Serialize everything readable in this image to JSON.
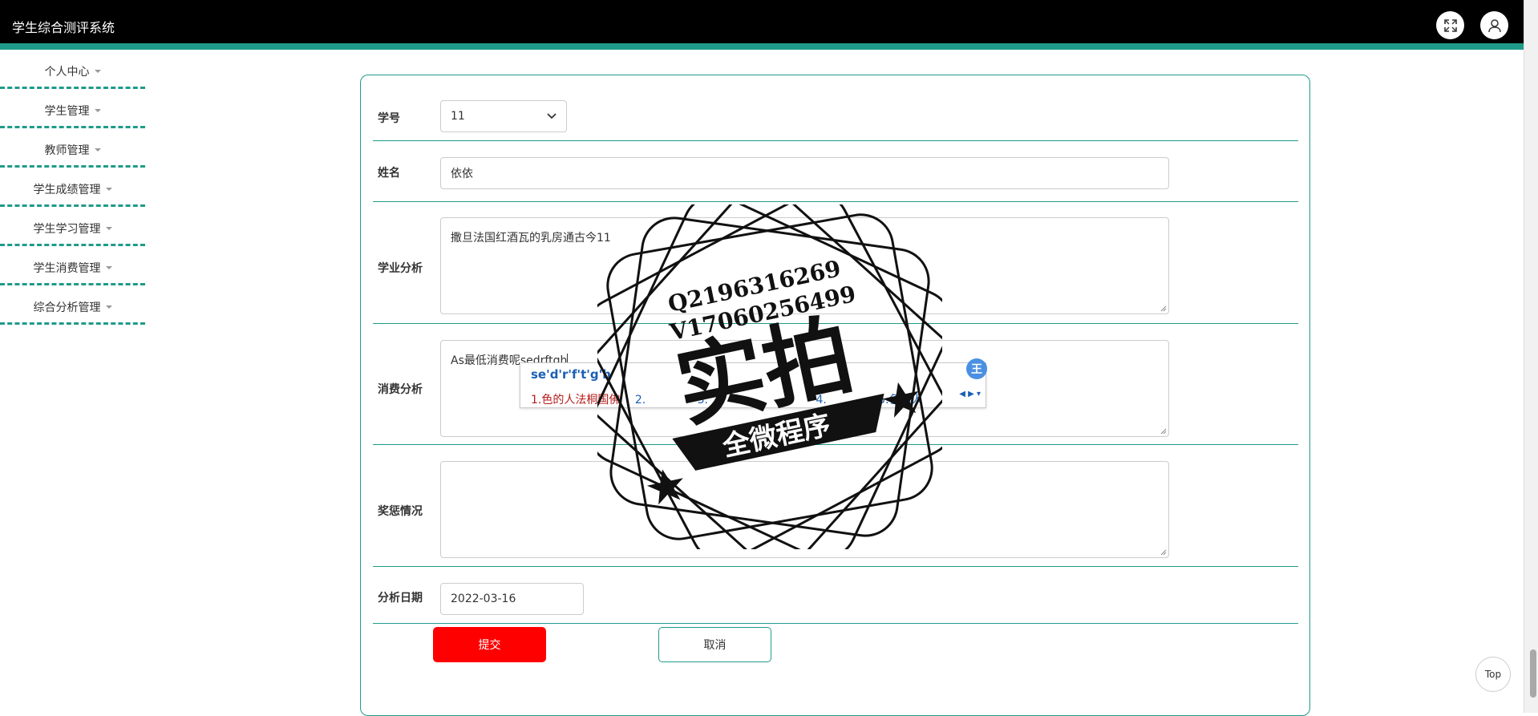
{
  "app": {
    "title": "学生综合测评系统"
  },
  "header": {
    "fullscreen_icon": "fullscreen-icon",
    "user_icon": "user-icon"
  },
  "sidebar": {
    "items": [
      {
        "label": "个人中心"
      },
      {
        "label": "学生管理"
      },
      {
        "label": "教师管理"
      },
      {
        "label": "学生成绩管理"
      },
      {
        "label": "学生学习管理"
      },
      {
        "label": "学生消费管理"
      },
      {
        "label": "综合分析管理"
      }
    ]
  },
  "form": {
    "student_id": {
      "label": "学号",
      "value": "11"
    },
    "name": {
      "label": "姓名",
      "value": "依依"
    },
    "academic_analysis": {
      "label": "学业分析",
      "value": "撒旦法国红酒瓦的乳房通古今11"
    },
    "consumption_analysis": {
      "label": "消费分析",
      "value": "As最低消费呢sedrftgh"
    },
    "awards": {
      "label": "奖惩情况",
      "value": ""
    },
    "analysis_date": {
      "label": "分析日期",
      "value": "2022-03-16"
    },
    "submit_label": "提交",
    "cancel_label": "取消"
  },
  "ime": {
    "composition": "se'd'r'f't'g'h",
    "candidates": [
      "1.色的人法桐国佛",
      "2.",
      "3.",
      "4.",
      "5.色的人"
    ],
    "badge": "王"
  },
  "watermark": {
    "line1": "Q2196316269",
    "line2": "V17060256499",
    "main": "实拍",
    "banner": "全微程序"
  },
  "back_to_top": "Top",
  "colors": {
    "accent": "#1f9b8a",
    "header": "#000000",
    "submit": "#ff0000"
  }
}
